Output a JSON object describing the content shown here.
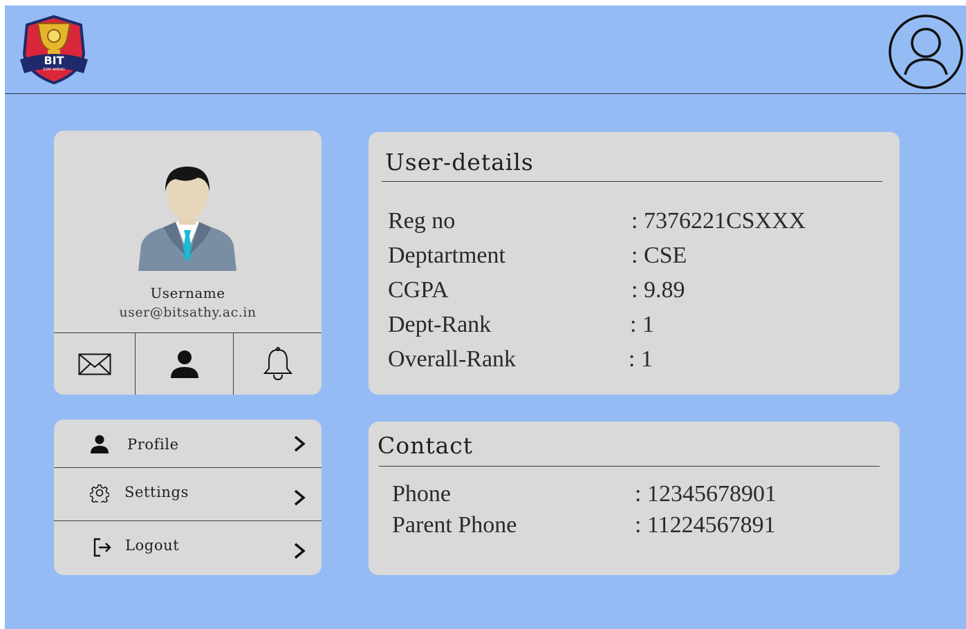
{
  "user_card": {
    "username": "Username",
    "email": "user@bitsathy.ac.in"
  },
  "icons": {
    "logo": "college-crest-logo",
    "account": "account-circle-icon",
    "mail": "mail-icon",
    "person": "person-icon",
    "bell": "bell-icon"
  },
  "menu": {
    "items": [
      {
        "label": "Profile",
        "icon": "person-icon"
      },
      {
        "label": "Settings",
        "icon": "gear-icon"
      },
      {
        "label": "Logout",
        "icon": "logout-icon"
      }
    ]
  },
  "details": {
    "title": "User-details",
    "rows": [
      {
        "label": "Reg no",
        "value": ": 7376221CSXXX"
      },
      {
        "label": "Deptartment",
        "value": ": CSE"
      },
      {
        "label": "CGPA",
        "value": ": 9.89"
      },
      {
        "label": "Dept-Rank",
        "value": ": 1"
      },
      {
        "label": "Overall-Rank",
        "value": ": 1"
      }
    ]
  },
  "contact": {
    "title": "Contact",
    "rows": [
      {
        "label": "Phone",
        "value": ": 12345678901"
      },
      {
        "label": "Parent Phone",
        "value": ": 11224567891"
      }
    ]
  },
  "colors": {
    "background": "#94bbf4",
    "card": "#d9d9d9",
    "text": "#1f1f1f"
  }
}
